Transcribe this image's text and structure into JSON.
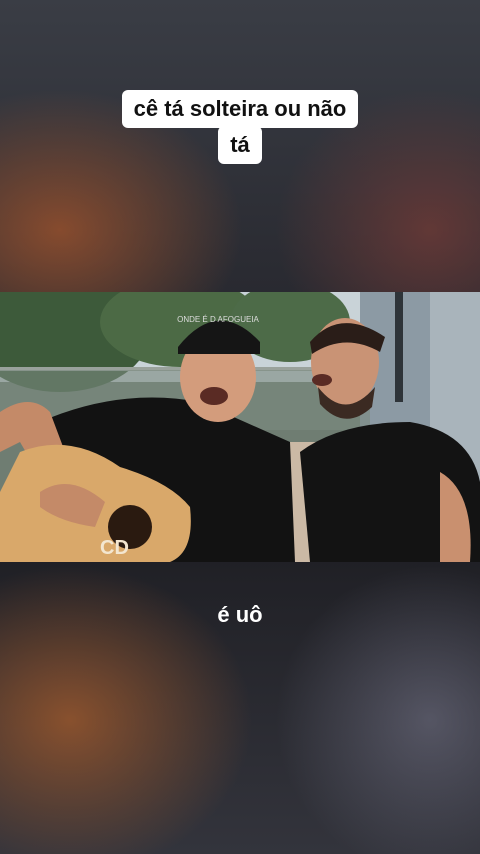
{
  "overlay": {
    "top_caption_line1": "cê tá solteira ou não",
    "top_caption_line2": "tá",
    "bottom_caption": "é uô"
  },
  "video": {
    "cap_text": "ONDE É D AFOGUEIA",
    "guitar_text": "CD"
  }
}
